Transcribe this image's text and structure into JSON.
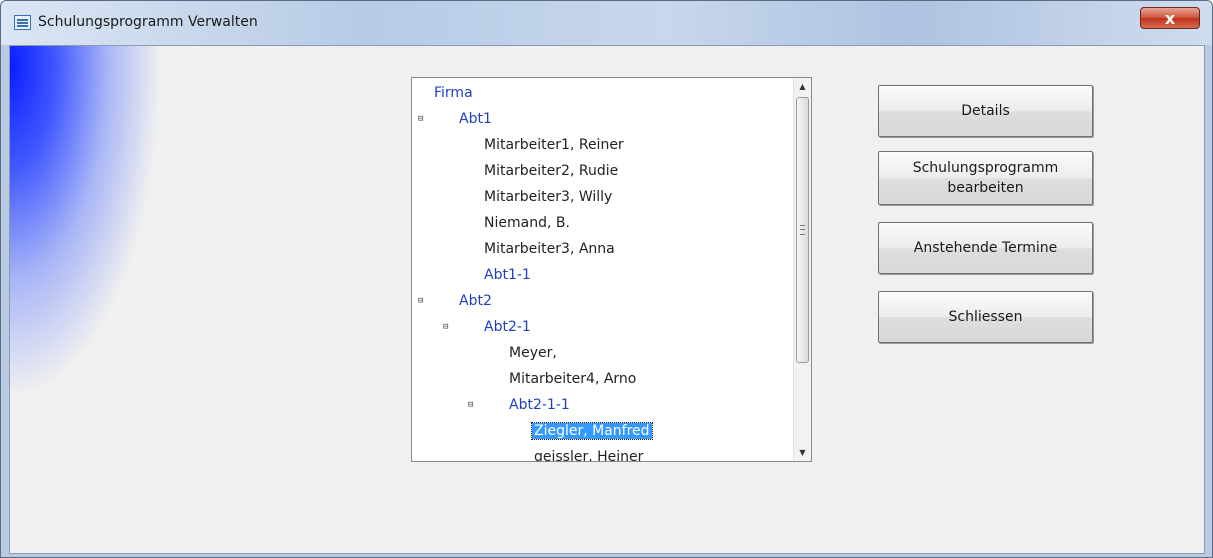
{
  "window": {
    "title": "Schulungsprogramm Verwalten",
    "close_symbol": "x"
  },
  "tree": {
    "rows": [
      {
        "label": "Firma",
        "kind": "dept"
      },
      {
        "label": "Abt1",
        "kind": "dept",
        "expander": "⊟"
      },
      {
        "label": "Mitarbeiter1, Reiner",
        "kind": "emp"
      },
      {
        "label": "Mitarbeiter2, Rudie",
        "kind": "emp"
      },
      {
        "label": "Mitarbeiter3, Willy",
        "kind": "emp"
      },
      {
        "label": "Niemand, B.",
        "kind": "emp"
      },
      {
        "label": "Mitarbeiter3, Anna",
        "kind": "emp"
      },
      {
        "label": "Abt1-1",
        "kind": "dept"
      },
      {
        "label": "Abt2",
        "kind": "dept",
        "expander": "⊟"
      },
      {
        "label": "Abt2-1",
        "kind": "dept",
        "expander": "⊟"
      },
      {
        "label": "Meyer,",
        "kind": "emp"
      },
      {
        "label": "Mitarbeiter4, Arno",
        "kind": "emp"
      },
      {
        "label": "Abt2-1-1",
        "kind": "dept",
        "expander": "⊟"
      },
      {
        "label": "Ziegler, Manfred",
        "kind": "emp",
        "selected": true
      },
      {
        "label": "geissler, Heiner",
        "kind": "emp"
      }
    ]
  },
  "buttons": {
    "details": "Details",
    "schulungsprogramm": "Schulungsprogramm\nbearbeiten",
    "termine": "Anstehende Termine",
    "schliessen": "Schliessen"
  }
}
